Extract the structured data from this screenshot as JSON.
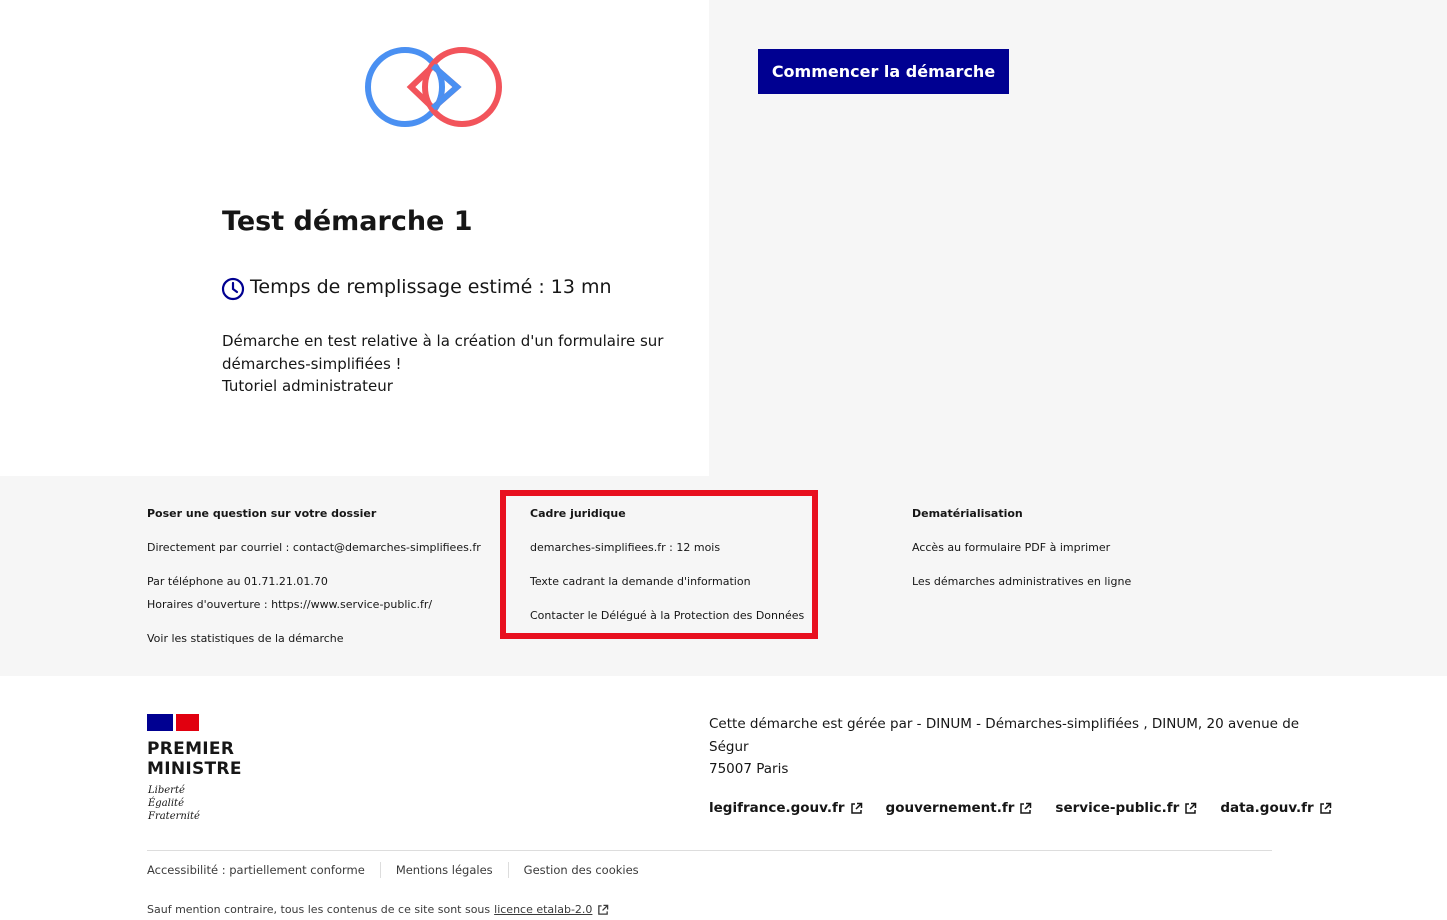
{
  "header": {
    "start_button_label": "Commencer la démarche"
  },
  "procedure": {
    "title": "Test démarche 1",
    "fill_time": "Temps de remplissage estimé : 13 mn",
    "description_line1": "Démarche en test relative à la création d'un formulaire sur",
    "description_line2": "démarches-simplifiées !",
    "description_line3": "Tutoriel administrateur"
  },
  "footer_columns": {
    "question": {
      "title": "Poser une question sur votre dossier",
      "email": "Directement par courriel : contact@demarches-simplifiees.fr",
      "phone": "Par téléphone au 01.71.21.01.70",
      "hours": "Horaires d'ouverture : https://www.service-public.fr/",
      "stats": "Voir les statistiques de la démarche"
    },
    "legal": {
      "title": "Cadre juridique",
      "retention": "demarches-simplifiees.fr : 12 mois",
      "text": "Texte cadrant la demande d'information",
      "dpo": "Contacter le Délégué à la Protection des Données"
    },
    "dematerialisation": {
      "title": "Dematérialisation",
      "pdf": "Accès au formulaire PDF à imprimer",
      "online": "Les démarches administratives en ligne"
    }
  },
  "footer": {
    "brand_line1": "PREMIER",
    "brand_line2": "MINISTRE",
    "motto_line1": "Liberté",
    "motto_line2": "Égalité",
    "motto_line3": "Fraternité",
    "managed_by_line1": "Cette démarche est gérée par - DINUM - Démarches-simplifiées , DINUM, 20 avenue de",
    "managed_by_line2": "Ségur",
    "managed_by_line3": "75007 Paris",
    "gov_links": [
      "legifrance.gouv.fr",
      "gouvernement.fr",
      "service-public.fr",
      "data.gouv.fr"
    ],
    "bottom_links": [
      "Accessibilité : partiellement conforme",
      "Mentions légales",
      "Gestion des cookies"
    ],
    "license_text": "Sauf mention contraire, tous les contenus de ce site sont sous",
    "license_link": "licence etalab-2.0"
  },
  "colors": {
    "primary": "#000091",
    "highlight": "#e8101f",
    "logo_blue": "#4a90f2",
    "logo_red": "#f2545b"
  }
}
